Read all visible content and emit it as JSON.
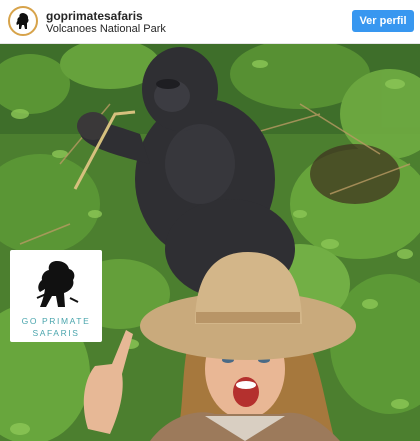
{
  "post": {
    "account_name": "goprimatesafaris",
    "location": "Volcanoes National Park",
    "profile_button_label": "Ver perfil",
    "avatar_icon": "primate-silhouette-icon"
  },
  "photo": {
    "logo": {
      "line1": "GO PRIMATE",
      "line2": "SAFARIS",
      "text_color": "#4aa5ad",
      "mark_icon": "primate-silhouette-icon"
    }
  },
  "colors": {
    "accent": "#3897f0",
    "foliage": "#4f8a2d",
    "gorilla": "#2f2f33",
    "hat": "#c9aa7c"
  }
}
